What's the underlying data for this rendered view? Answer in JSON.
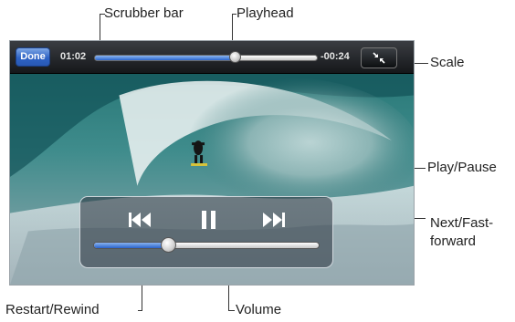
{
  "player": {
    "done_label": "Done",
    "elapsed": "01:02",
    "remaining": "-00:24",
    "playback_progress": 0.63,
    "volume_level": 0.33,
    "accent_color": "#2e63c5"
  },
  "controls": {
    "rewind_icon": "skip-back-icon",
    "play_pause_icon": "pause-icon",
    "forward_icon": "skip-forward-icon",
    "scale_icon": "scale-icon"
  },
  "callouts": {
    "scrubber_bar": "Scrubber bar",
    "playhead": "Playhead",
    "scale": "Scale",
    "play_pause": "Play/Pause",
    "next_line1": "Next/Fast-",
    "next_line2": "forward",
    "restart_rewind": "Restart/Rewind",
    "volume": "Volume"
  }
}
